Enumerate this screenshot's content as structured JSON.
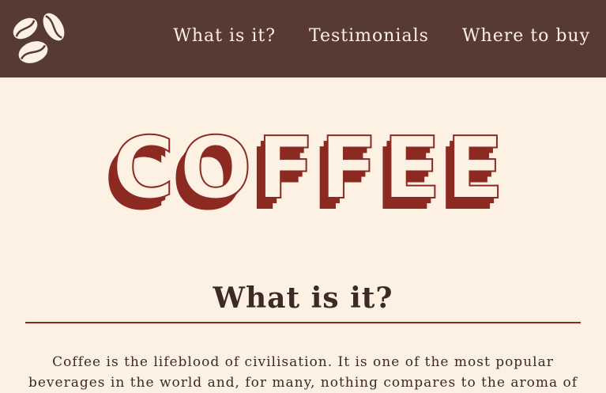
{
  "header": {
    "logo_icon": "coffee-beans-icon",
    "nav": [
      {
        "label": "What is it?"
      },
      {
        "label": "Testimonials"
      },
      {
        "label": "Where to buy"
      }
    ]
  },
  "hero": {
    "title": "COFFEE"
  },
  "section": {
    "title": "What is it?",
    "paragraph": "Coffee is the lifeblood of civilisation. It is one of the most popular beverages in the world and, for many, nothing compares to the aroma of"
  },
  "colors": {
    "header_bg": "#573a33",
    "page_bg": "#fdf1e4",
    "accent": "#8c2a22",
    "text": "#3b2a26"
  }
}
